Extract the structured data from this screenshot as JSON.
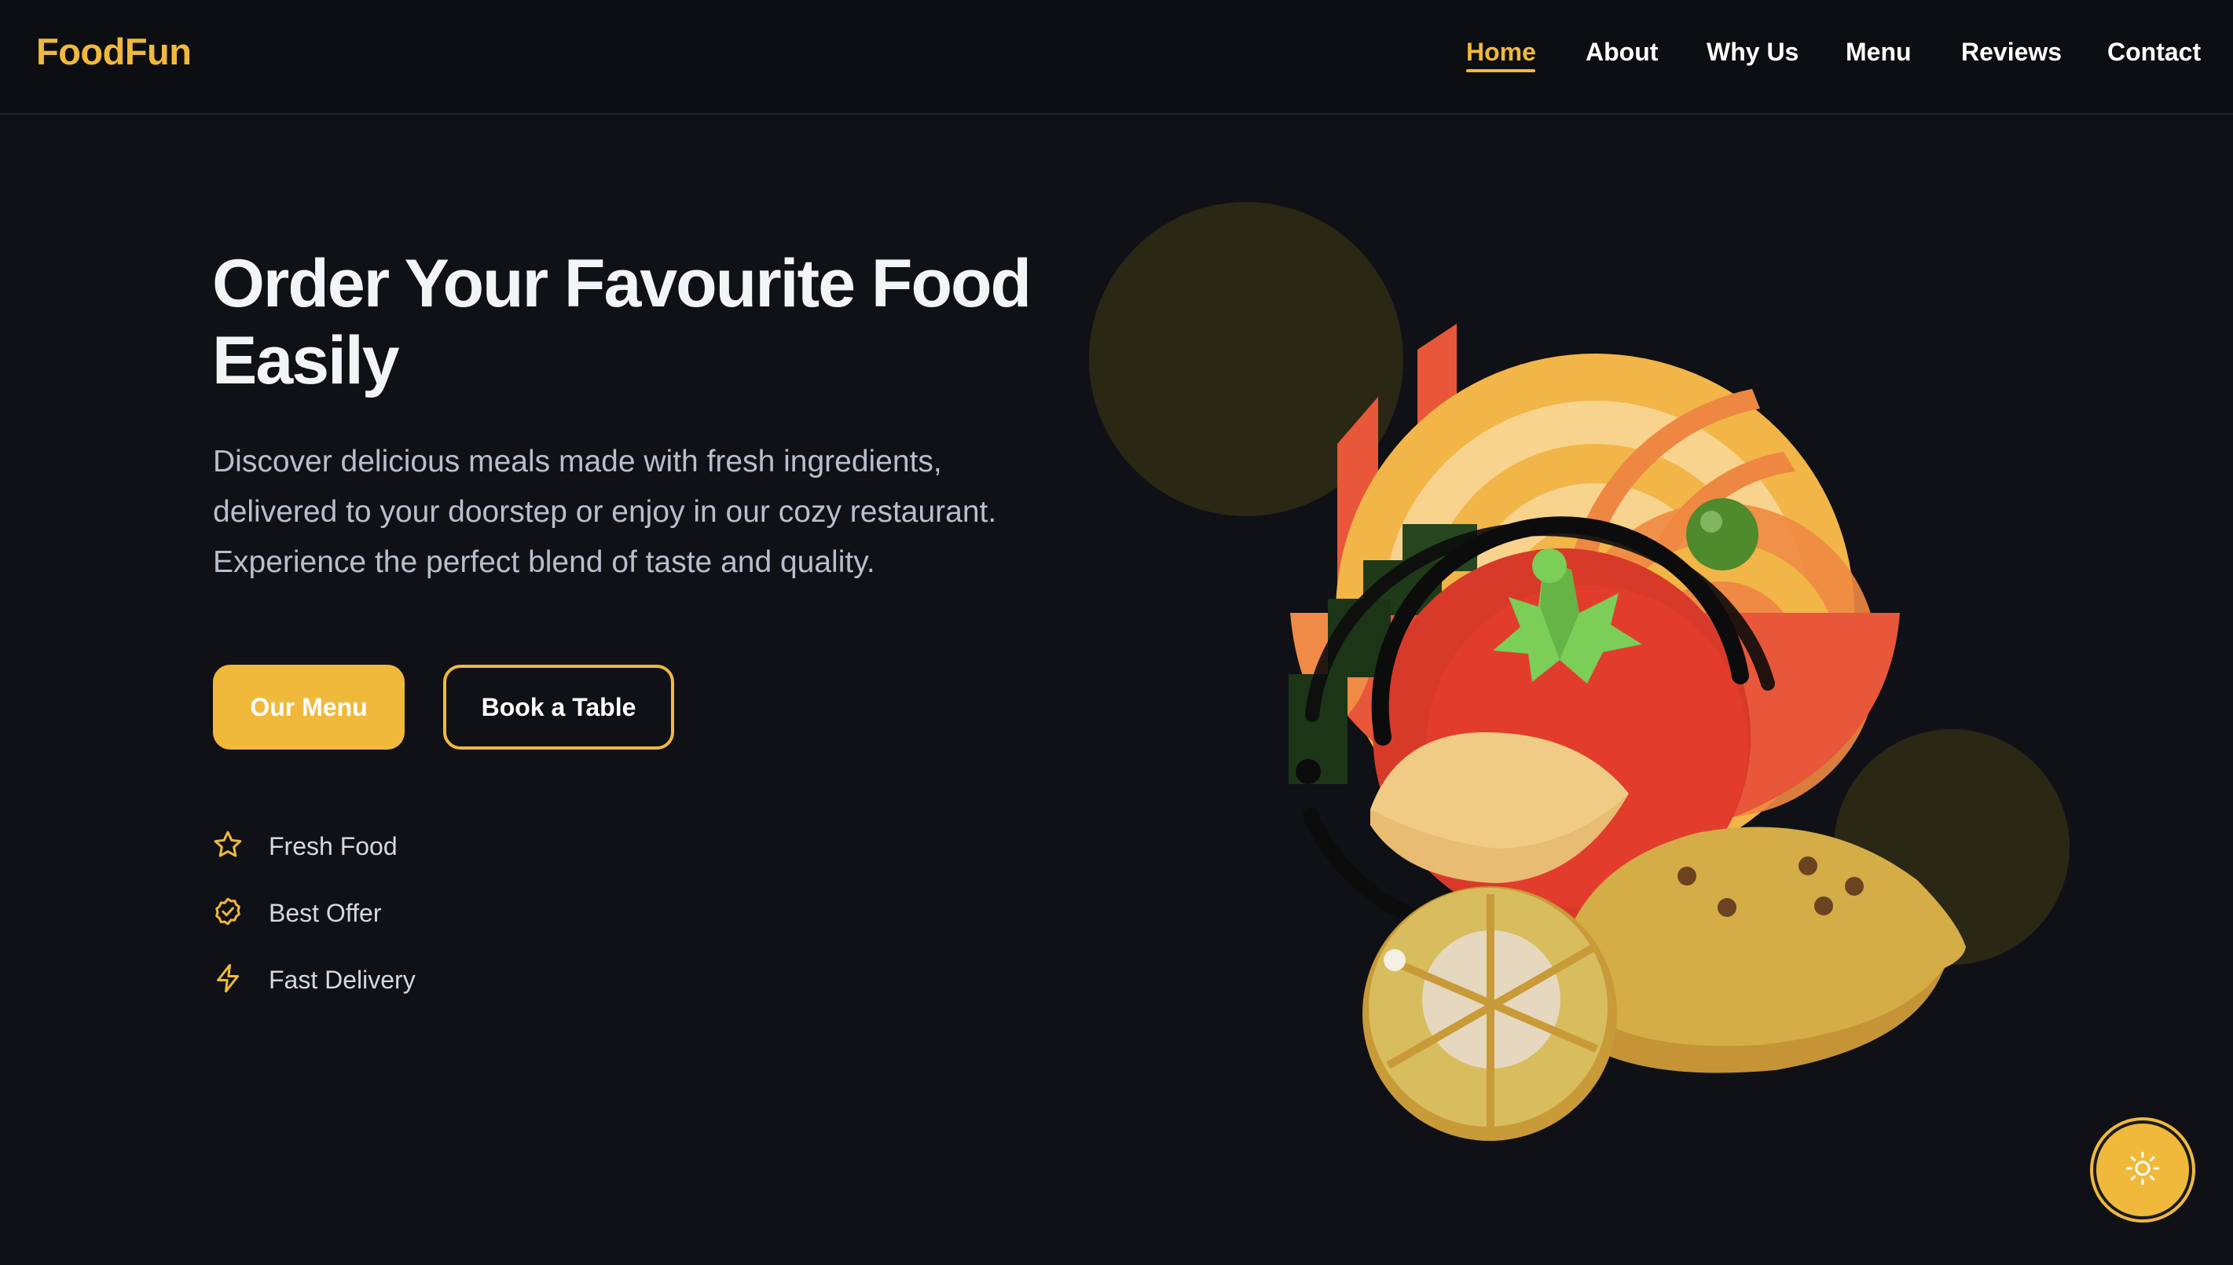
{
  "brand": {
    "name": "FoodFun"
  },
  "nav": {
    "items": [
      {
        "label": "Home",
        "active": true
      },
      {
        "label": "About"
      },
      {
        "label": "Why Us"
      },
      {
        "label": "Menu"
      },
      {
        "label": "Reviews"
      },
      {
        "label": "Contact"
      }
    ]
  },
  "hero": {
    "title": "Order Your Favourite Food Easily",
    "description": "Discover delicious meals made with fresh ingredients, delivered to your doorstep or enjoy in our cozy restaurant. Experience the perfect blend of taste and quality.",
    "primary_button": "Our Menu",
    "secondary_button": "Book a Table"
  },
  "features": [
    {
      "label": "Fresh Food",
      "icon": "star-icon"
    },
    {
      "label": "Best Offer",
      "icon": "badge-check-icon"
    },
    {
      "label": "Fast Delivery",
      "icon": "lightning-icon"
    }
  ],
  "theme_toggle": {
    "icon": "sun-icon"
  },
  "colors": {
    "accent": "#f0b93c",
    "background": "#101116",
    "navbar": "#0d0e12",
    "text_primary": "#f3f4f6",
    "text_muted": "#b8bfcc"
  }
}
